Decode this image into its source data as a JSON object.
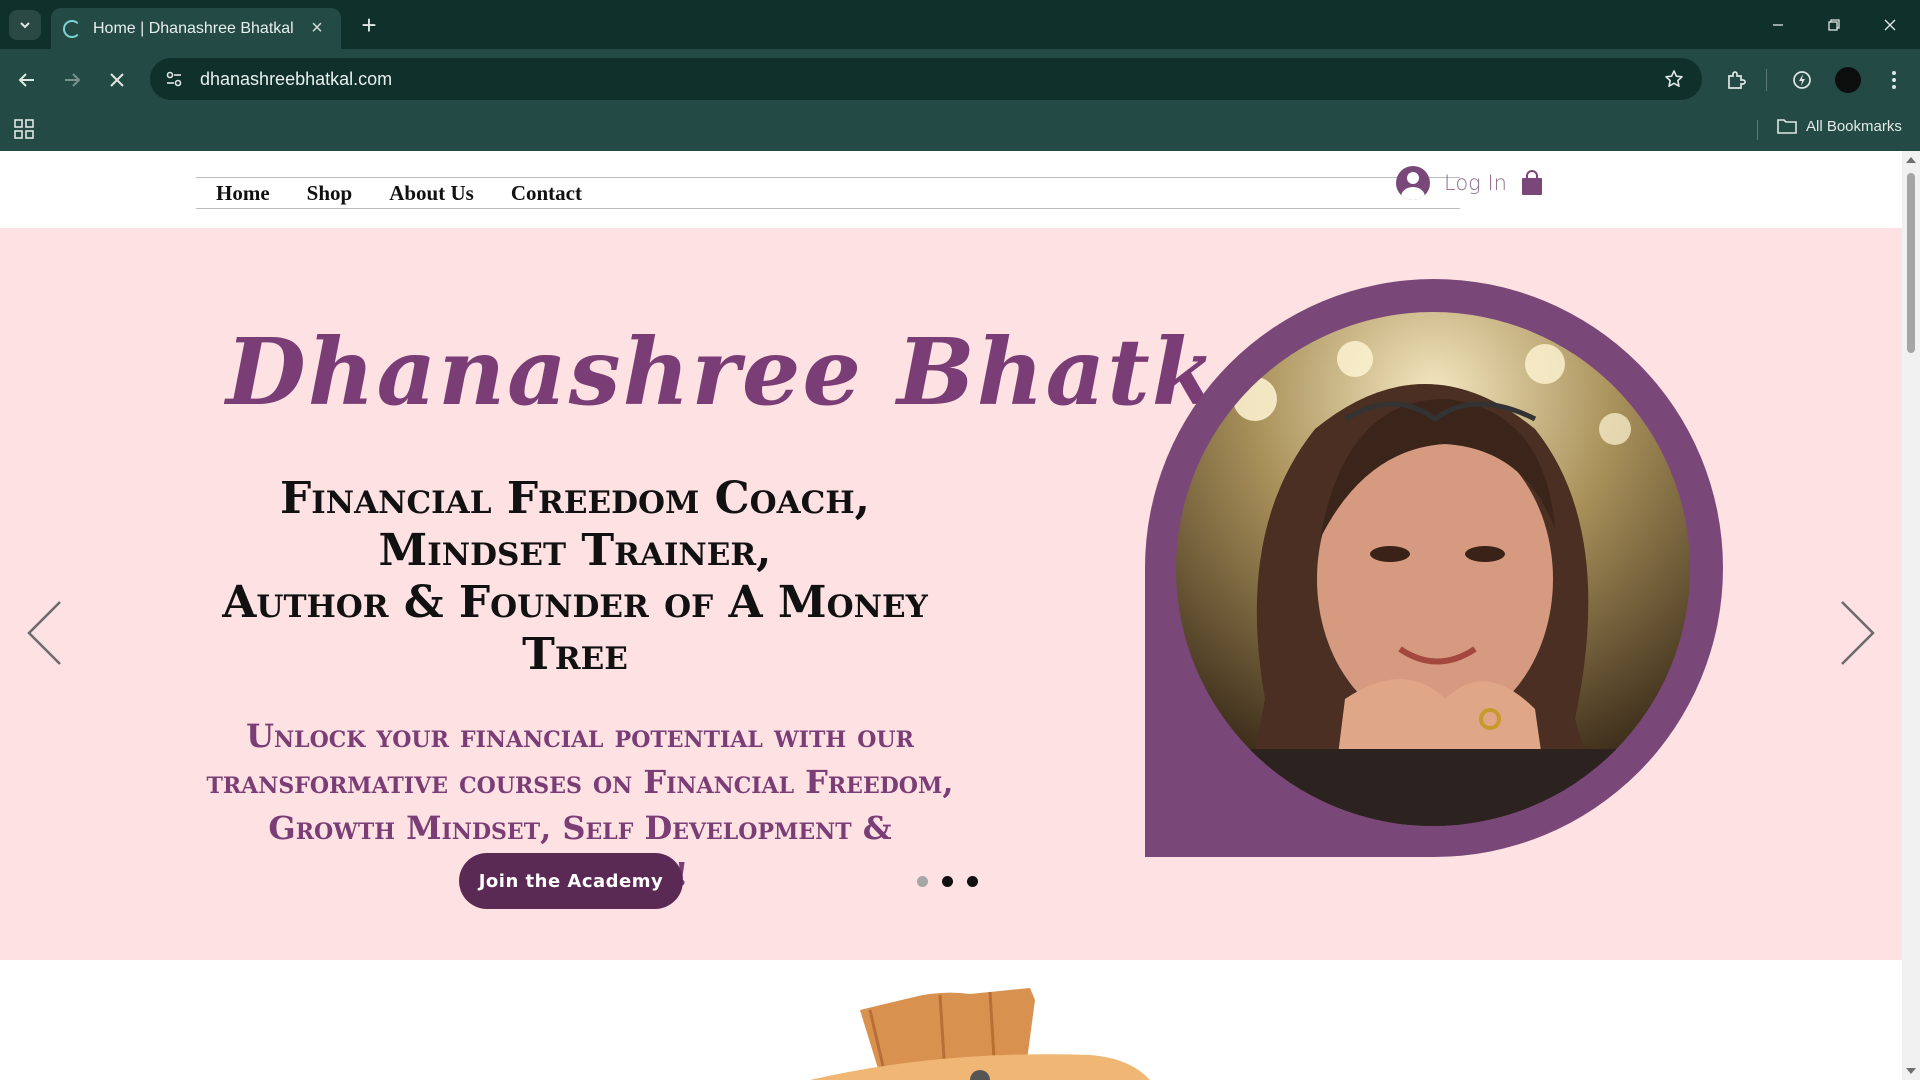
{
  "browser": {
    "tab_title": "Home | Dhanashree Bhatkal",
    "url": "dhanashreebhatkal.com",
    "bookmarks_label": "All Bookmarks"
  },
  "site": {
    "nav": [
      "Home",
      "Shop",
      "About Us",
      "Contact"
    ],
    "login_label": "Log In"
  },
  "hero": {
    "name": "Dhanashree Bhatkal",
    "tagline_line1": "Financial Freedom Coach, Mindset Trainer,",
    "tagline_line2": "Author & Founder of A Money Tree",
    "description": "Unlock your financial potential with our transformative courses on Financial Freedom, Growth Mindset, Self Development & Mindfulness!",
    "cta_label": "Join the Academy",
    "slide_dots": [
      {
        "active": false
      },
      {
        "active": true
      },
      {
        "active": true
      }
    ]
  },
  "colors": {
    "hero_bg": "#fde1e3",
    "brand_purple": "#7a3d76",
    "cta_bg": "#5a2a55",
    "chrome_dark": "#10302c",
    "chrome_mid": "#234a45"
  },
  "icons": [
    "tab-search-icon",
    "loading-spinner-icon",
    "close-icon",
    "plus-icon",
    "minimize-icon",
    "restore-icon",
    "back-icon",
    "forward-icon",
    "stop-icon",
    "site-info-icon",
    "star-icon",
    "extensions-icon",
    "vpn-icon",
    "apps-icon",
    "folder-icon",
    "user-avatar-icon",
    "shopping-bag-icon",
    "chevron-left-icon",
    "chevron-right-icon"
  ]
}
